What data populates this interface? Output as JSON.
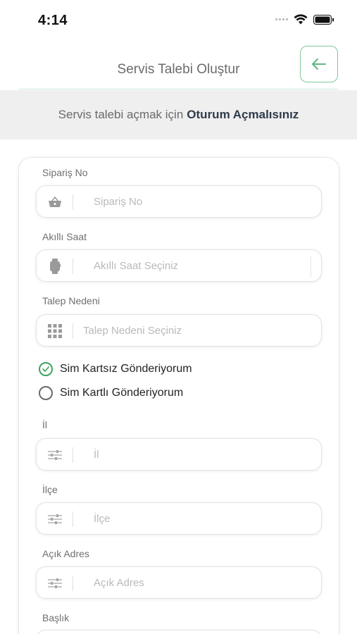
{
  "status_bar": {
    "time": "4:14"
  },
  "header": {
    "title": "Servis Talebi Oluştur"
  },
  "notice": {
    "prefix": "Servis talebi açmak için",
    "emphasis": "Oturum Açmalısınız"
  },
  "form": {
    "fields": [
      {
        "label": "Sipariş No",
        "placeholder": "Sipariş No",
        "icon": "basket-icon"
      },
      {
        "label": "Akıllı Saat",
        "placeholder": "Akıllı Saat Seçiniz",
        "icon": "smartwatch-icon"
      },
      {
        "label": "Talep Nedeni",
        "placeholder": "Talep Nedeni Seçiniz",
        "icon": "grid-icon"
      },
      {
        "label": "İl",
        "placeholder": "İl",
        "icon": "sliders-icon"
      },
      {
        "label": "İlçe",
        "placeholder": "İlçe",
        "icon": "sliders-icon"
      },
      {
        "label": "Açık Adres",
        "placeholder": "Açık Adres",
        "icon": "sliders-icon"
      },
      {
        "label": "Başlık"
      }
    ],
    "radios": [
      {
        "label": "Sim Kartsız Gönderiyorum",
        "checked": true
      },
      {
        "label": "Sim Kartlı Gönderiyorum",
        "checked": false
      }
    ]
  },
  "colors": {
    "accent": "#3aa55f",
    "border_accent": "#7ec79b",
    "notice_bg": "#efefef"
  }
}
